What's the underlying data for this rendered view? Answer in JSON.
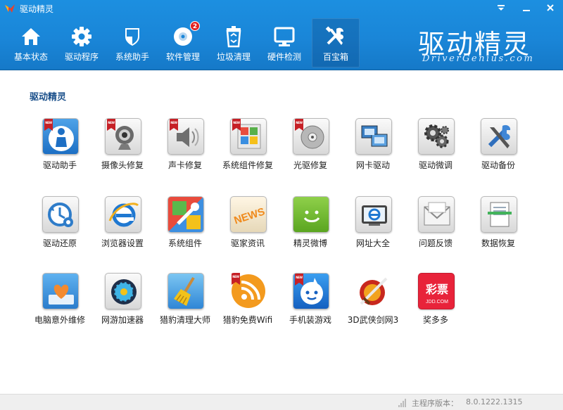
{
  "window": {
    "title": "驱动精灵",
    "controls": [
      "menu-arrow",
      "minimize",
      "close"
    ]
  },
  "toolbar": {
    "tabs": [
      {
        "label": "基本状态",
        "icon": "home-icon"
      },
      {
        "label": "驱动程序",
        "icon": "gear-icon"
      },
      {
        "label": "系统助手",
        "icon": "shield-icon"
      },
      {
        "label": "软件管理",
        "icon": "disc-icon",
        "badge": "2"
      },
      {
        "label": "垃圾清理",
        "icon": "trash-icon"
      },
      {
        "label": "硬件检测",
        "icon": "monitor-icon"
      },
      {
        "label": "百宝箱",
        "icon": "tools-icon",
        "active": true
      }
    ]
  },
  "brand": {
    "name": "驱动精灵",
    "site": "DriverGenius.com"
  },
  "main": {
    "section_title": "驱动精灵",
    "tools": [
      {
        "label": "驱动助手",
        "icon": "driver-helper-icon",
        "new": true
      },
      {
        "label": "摄像头修复",
        "icon": "webcam-icon",
        "new": true
      },
      {
        "label": "声卡修复",
        "icon": "speaker-icon",
        "new": true
      },
      {
        "label": "系统组件修复",
        "icon": "windows-component-icon",
        "new": true
      },
      {
        "label": "光驱修复",
        "icon": "cd-drive-icon",
        "new": true
      },
      {
        "label": "网卡驱动",
        "icon": "network-card-icon"
      },
      {
        "label": "驱动微调",
        "icon": "gears-icon"
      },
      {
        "label": "驱动备份",
        "icon": "wrench-backup-icon"
      },
      {
        "label": "驱动还原",
        "icon": "restore-icon"
      },
      {
        "label": "浏览器设置",
        "icon": "browser-icon"
      },
      {
        "label": "系统组件",
        "icon": "system-component-icon"
      },
      {
        "label": "驱家资讯",
        "icon": "news-icon",
        "icon_text": "NEWS"
      },
      {
        "label": "精灵微博",
        "icon": "weibo-icon"
      },
      {
        "label": "网址大全",
        "icon": "web-directory-icon"
      },
      {
        "label": "问题反馈",
        "icon": "feedback-mail-icon"
      },
      {
        "label": "数据恢复",
        "icon": "data-recovery-icon"
      },
      {
        "label": "电脑意外维修",
        "icon": "heart-repair-icon"
      },
      {
        "label": "网游加速器",
        "icon": "game-accelerator-icon"
      },
      {
        "label": "猎豹清理大师",
        "icon": "cleaner-broom-icon"
      },
      {
        "label": "猎豹免费Wifi",
        "icon": "wifi-icon",
        "new": true
      },
      {
        "label": "手机装游戏",
        "icon": "mobile-game-icon",
        "new": true
      },
      {
        "label": "3D武侠剑网3",
        "icon": "jx3-game-icon"
      },
      {
        "label": "奖多多",
        "icon": "lottery-icon",
        "icon_text": "彩票",
        "icon_subtext": "JDD.COM"
      }
    ]
  },
  "status": {
    "version_label": "主程序版本：",
    "version_value": "8.0.1222.1315"
  },
  "colors": {
    "topbar": "#1a86d8",
    "section_title": "#1a4f8a",
    "badge": "#e22222",
    "ribbon": "#c62026"
  }
}
